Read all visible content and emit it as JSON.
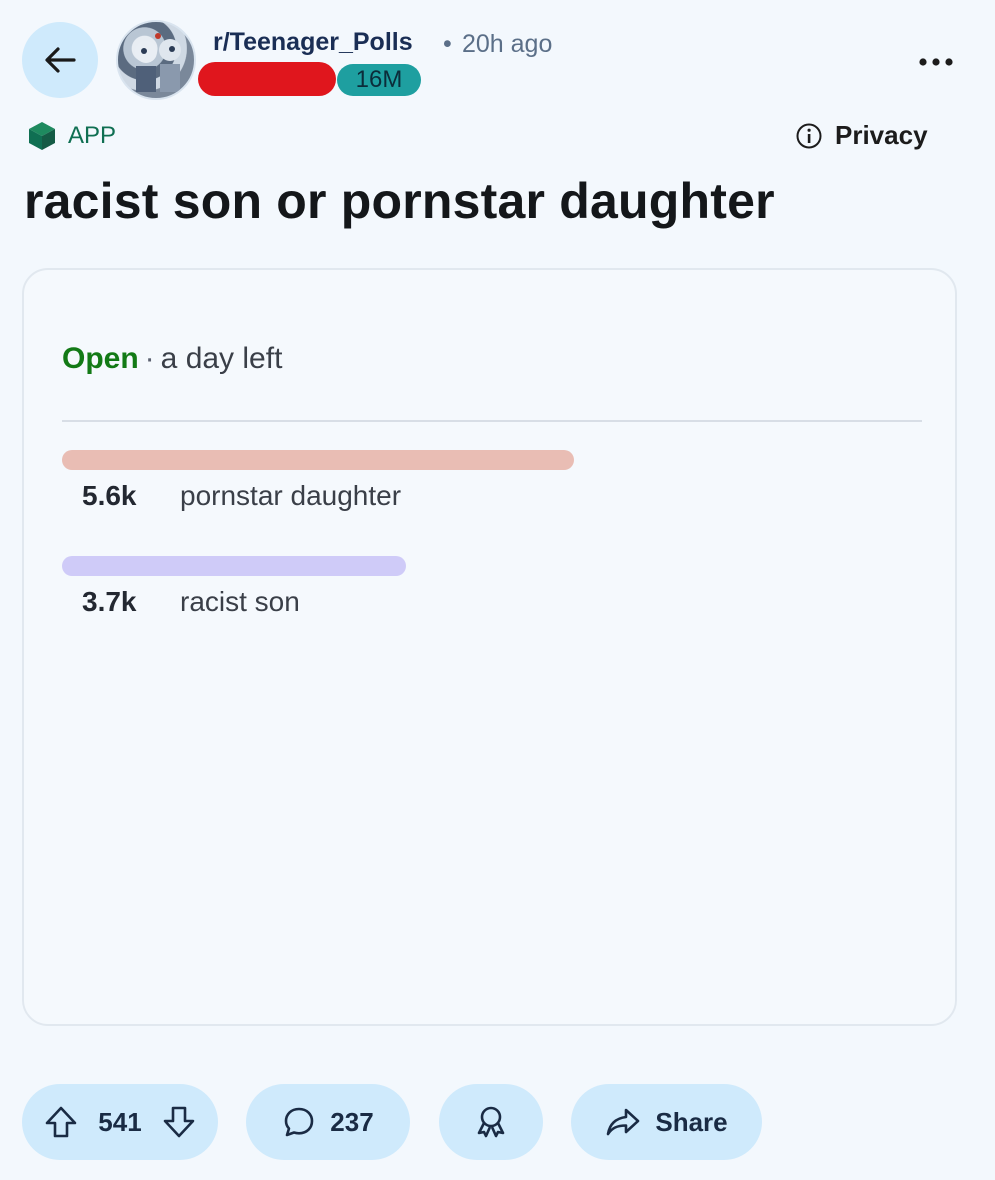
{
  "header": {
    "subreddit": "r/Teenager_Polls",
    "separator": "•",
    "time_ago": "20h ago",
    "flair": "16M"
  },
  "tags": {
    "app_label": "APP",
    "privacy_label": "Privacy"
  },
  "post": {
    "title": "racist son or pornstar daughter"
  },
  "poll": {
    "status": "Open",
    "status_separator": "·",
    "time_left": "a day left",
    "options": [
      {
        "count": "5.6k",
        "label": "pornstar daughter",
        "color": "#e9bdb4",
        "fill_fraction": 0.595
      },
      {
        "count": "3.7k",
        "label": "racist son",
        "color": "#cfcbf8",
        "fill_fraction": 0.4
      }
    ]
  },
  "actions": {
    "upvotes": "541",
    "comments": "237",
    "share_label": "Share"
  },
  "colors": {
    "background": "#f3f8fd",
    "button_bg": "#cfeafc",
    "open_green": "#137a16",
    "flair_teal": "#1e9fa0",
    "redaction_red": "#e0161d"
  }
}
